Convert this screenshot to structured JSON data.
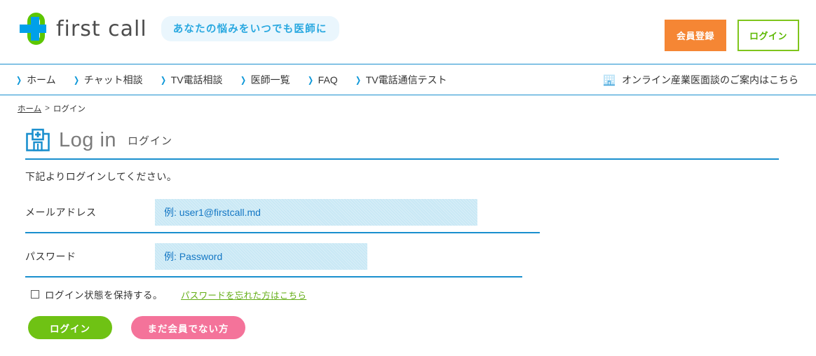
{
  "header": {
    "logo_text": "first call",
    "logo_icon": "first-call-cross-logo",
    "tagline": "あなたの悩みをいつでも医師に",
    "register_label": "会員登録",
    "login_label": "ログイン",
    "colors": {
      "orange": "#f58634",
      "green": "#7fc51c",
      "blue": "#00a0e9",
      "logo_green": "#5cc600"
    }
  },
  "nav": {
    "items": [
      {
        "label": "ホーム",
        "icon": "chevron-right-icon"
      },
      {
        "label": "チャット相談",
        "icon": "chevron-right-icon"
      },
      {
        "label": "TV電話相談",
        "icon": "chevron-right-icon"
      },
      {
        "label": "医師一覧",
        "icon": "chevron-right-icon"
      },
      {
        "label": "FAQ",
        "icon": "chevron-right-icon"
      },
      {
        "label": "TV電話通信テスト",
        "icon": "chevron-right-icon"
      }
    ],
    "right_link": {
      "label": "オンライン産業医面談のご案内はこちら",
      "icon": "office-building-icon"
    },
    "border_color": "#1a8fce"
  },
  "breadcrumb": {
    "home": "ホーム",
    "separator": ">",
    "current": "ログイン"
  },
  "page": {
    "icon": "hospital-icon",
    "title_en": "Log in",
    "title_jp": "ログイン",
    "intro": "下記よりログインしてください。"
  },
  "form": {
    "email": {
      "label": "メールアドレス",
      "placeholder": "例: user1@firstcall.md",
      "value": ""
    },
    "password": {
      "label": "パスワード",
      "placeholder": "例: Password",
      "value": ""
    },
    "remember": {
      "label": "ログイン状態を保持する。",
      "checked": false
    },
    "forgot_link": "パスワードを忘れた方はこちら",
    "submit_label": "ログイン",
    "signup_label": "まだ会員でない方",
    "colors": {
      "input_bg": "#c9e8f5",
      "input_text": "#1477c4",
      "submit_green": "#6fc214",
      "signup_pink": "#f4739a",
      "link_green": "#63ad15"
    }
  }
}
